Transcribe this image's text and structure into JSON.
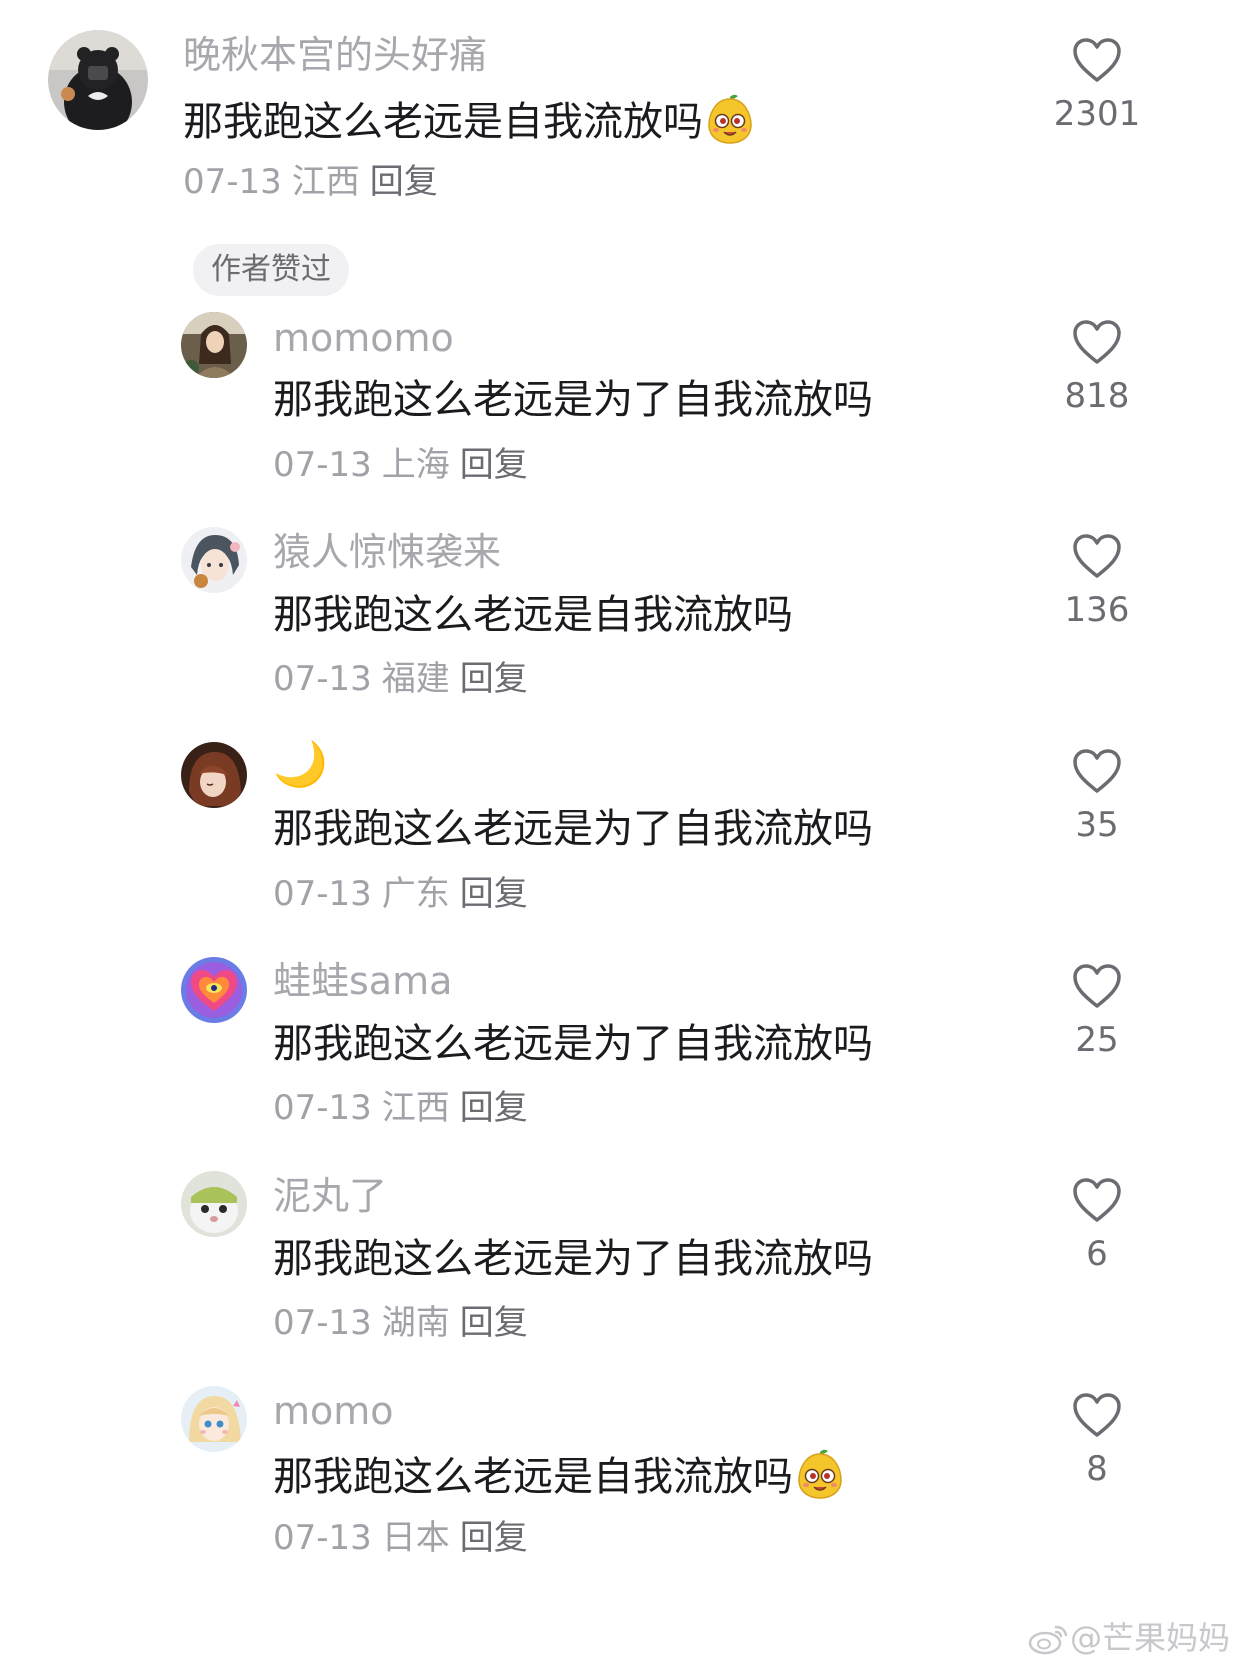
{
  "comments": [
    {
      "username": "晚秋本宫的头好痛",
      "text": "那我跑这么老远是自我流放吗",
      "has_sticker": true,
      "date": "07-13",
      "location": "江西",
      "reply": "回复",
      "likes": "2301",
      "badge": "作者赞过"
    },
    {
      "username": "momomo",
      "text": "那我跑这么老远是为了自我流放吗",
      "date": "07-13",
      "location": "上海",
      "reply": "回复",
      "likes": "818"
    },
    {
      "username": "猿人惊悚袭来",
      "text": "那我跑这么老远是自我流放吗",
      "date": "07-13",
      "location": "福建",
      "reply": "回复",
      "likes": "136"
    },
    {
      "username": "🌙",
      "text": "那我跑这么老远是为了自我流放吗",
      "date": "07-13",
      "location": "广东",
      "reply": "回复",
      "likes": "35"
    },
    {
      "username": "蛙蛙sama",
      "text": "那我跑这么老远是为了自我流放吗",
      "date": "07-13",
      "location": "江西",
      "reply": "回复",
      "likes": "25"
    },
    {
      "username": "泥丸了",
      "text": "那我跑这么老远是为了自我流放吗",
      "date": "07-13",
      "location": "湖南",
      "reply": "回复",
      "likes": "6"
    },
    {
      "username": "momo",
      "text": "那我跑这么老远是自我流放吗",
      "has_sticker": true,
      "date": "07-13",
      "location": "日本",
      "reply": "回复",
      "likes": "8"
    }
  ],
  "watermark": "@芒果妈妈",
  "icons": {
    "like": "heart-outline-icon",
    "sticker": "mango-face-sticker",
    "watermark": "weibo-logo-icon"
  },
  "colors": {
    "username": "#a7a7ad",
    "text": "#1b1b1f",
    "meta": "#a1a1a8",
    "reply": "#6b6b72",
    "badge_bg": "#f1f1f3"
  }
}
